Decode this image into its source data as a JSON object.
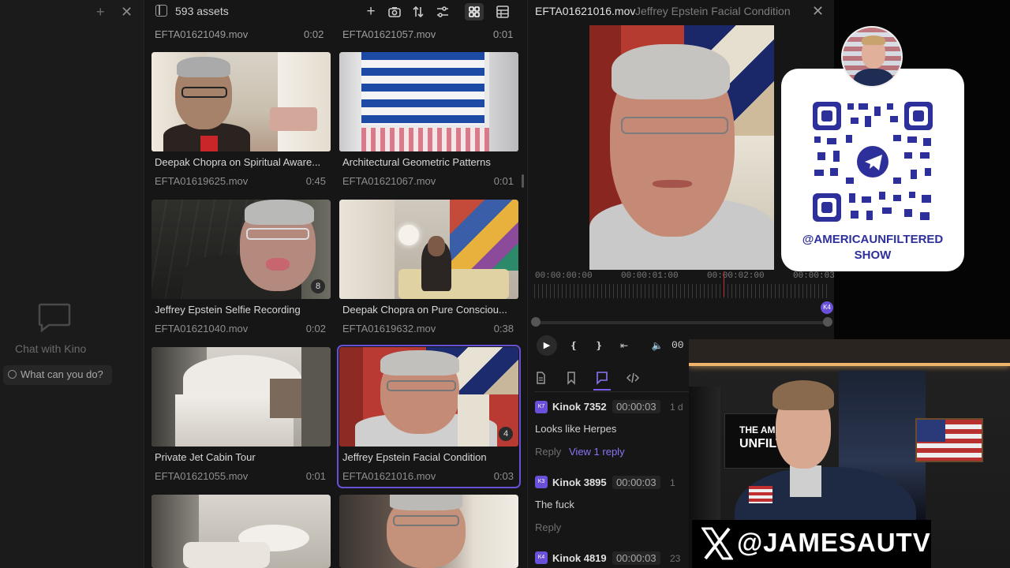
{
  "left_panel": {
    "chat_label": "Chat with Kino",
    "ask_chip": "What can you do?"
  },
  "grid": {
    "asset_count": "593 assets",
    "top_row": [
      {
        "filename": "EFTA01621049.mov",
        "duration": "0:02"
      },
      {
        "filename": "EFTA01621057.mov",
        "duration": "0:01"
      }
    ],
    "cards": [
      {
        "title": "Deepak Chopra on Spiritual Aware...",
        "filename": "EFTA01619625.mov",
        "duration": "0:45",
        "badge": ""
      },
      {
        "title": "Architectural Geometric Patterns",
        "filename": "EFTA01621067.mov",
        "duration": "0:01",
        "badge": ""
      },
      {
        "title": "Jeffrey Epstein Selfie Recording",
        "filename": "EFTA01621040.mov",
        "duration": "0:02",
        "badge": "8"
      },
      {
        "title": "Deepak Chopra on Pure Consciou...",
        "filename": "EFTA01619632.mov",
        "duration": "0:38",
        "badge": ""
      },
      {
        "title": "Private Jet Cabin Tour",
        "filename": "EFTA01621055.mov",
        "duration": "0:01",
        "badge": ""
      },
      {
        "title": "Jeffrey Epstein Facial Condition",
        "filename": "EFTA01621016.mov",
        "duration": "0:03",
        "badge": "4"
      }
    ]
  },
  "detail": {
    "filename": "EFTA01621016.mov",
    "title": "Jeffrey Epstein Facial Condition",
    "timecodes": [
      "00:00:00:00",
      "00:00:01:00",
      "00:00:02:00",
      "00:00:03:"
    ],
    "marker": "K4",
    "control_time": "00",
    "comments": [
      {
        "avatar": "K7",
        "user": "Kinok 7352",
        "time": "00:00:03",
        "ago": "1 d",
        "text": "Looks like Herpes",
        "reply": "Reply",
        "view": "View 1 reply"
      },
      {
        "avatar": "K3",
        "user": "Kinok 3895",
        "time": "00:00:03",
        "ago": "1",
        "text": "The fuck",
        "reply": "Reply",
        "view": ""
      },
      {
        "avatar": "K4",
        "user": "Kinok 4819",
        "time": "00:00:03",
        "ago": "23",
        "text": "",
        "reply": "",
        "view": ""
      }
    ]
  },
  "overlay": {
    "qr_handle_line1": "@AMERICAUNFILTERED",
    "qr_handle_line2": "SHOW",
    "x_handle": "@JAMESAUTV",
    "wall_sign_line1": "THE AME",
    "wall_sign_line2": "UNFILT"
  },
  "colors": {
    "accent": "#6a4fd8",
    "panel_bg": "#161616",
    "qr_blue": "#2d2f9a"
  }
}
